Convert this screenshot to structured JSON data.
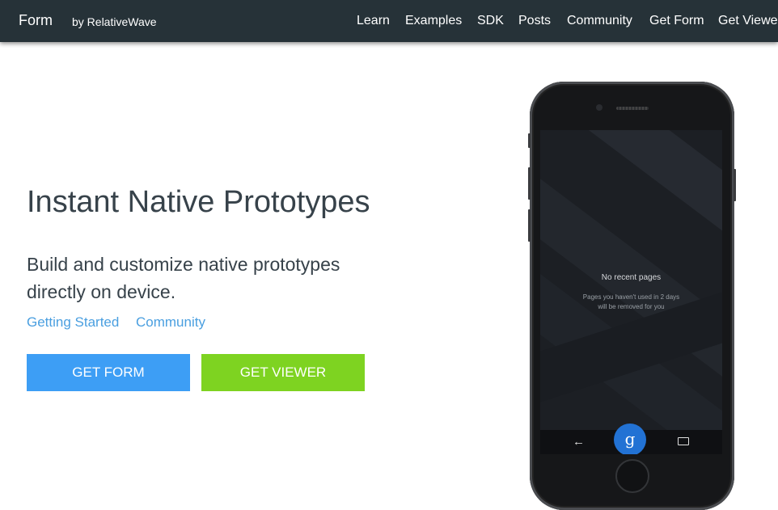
{
  "navbar": {
    "brand": "Form",
    "brand_sub": "by RelativeWave",
    "links": [
      "Learn",
      "Examples",
      "SDK",
      "Posts",
      "Community",
      "Get Form",
      "Get Viewer"
    ]
  },
  "hero": {
    "title": "Instant Native Prototypes",
    "subtitle_line1": "Build and customize native prototypes",
    "subtitle_line2": "directly on device.",
    "links": [
      "Getting Started",
      "Community"
    ],
    "buttons": {
      "get_form": "GET FORM",
      "get_viewer": "GET VIEWER"
    }
  },
  "phone_screen": {
    "empty_title": "No recent pages",
    "empty_hint_line1": "Pages you haven't used in 2 days",
    "empty_hint_line2": "will be removed for you",
    "search_glyph": "g",
    "back_glyph": "←"
  },
  "colors": {
    "navbar_bg": "#263238",
    "form_button": "#3d9ef5",
    "viewer_button": "#7ed321",
    "link": "#4a9fe0"
  }
}
